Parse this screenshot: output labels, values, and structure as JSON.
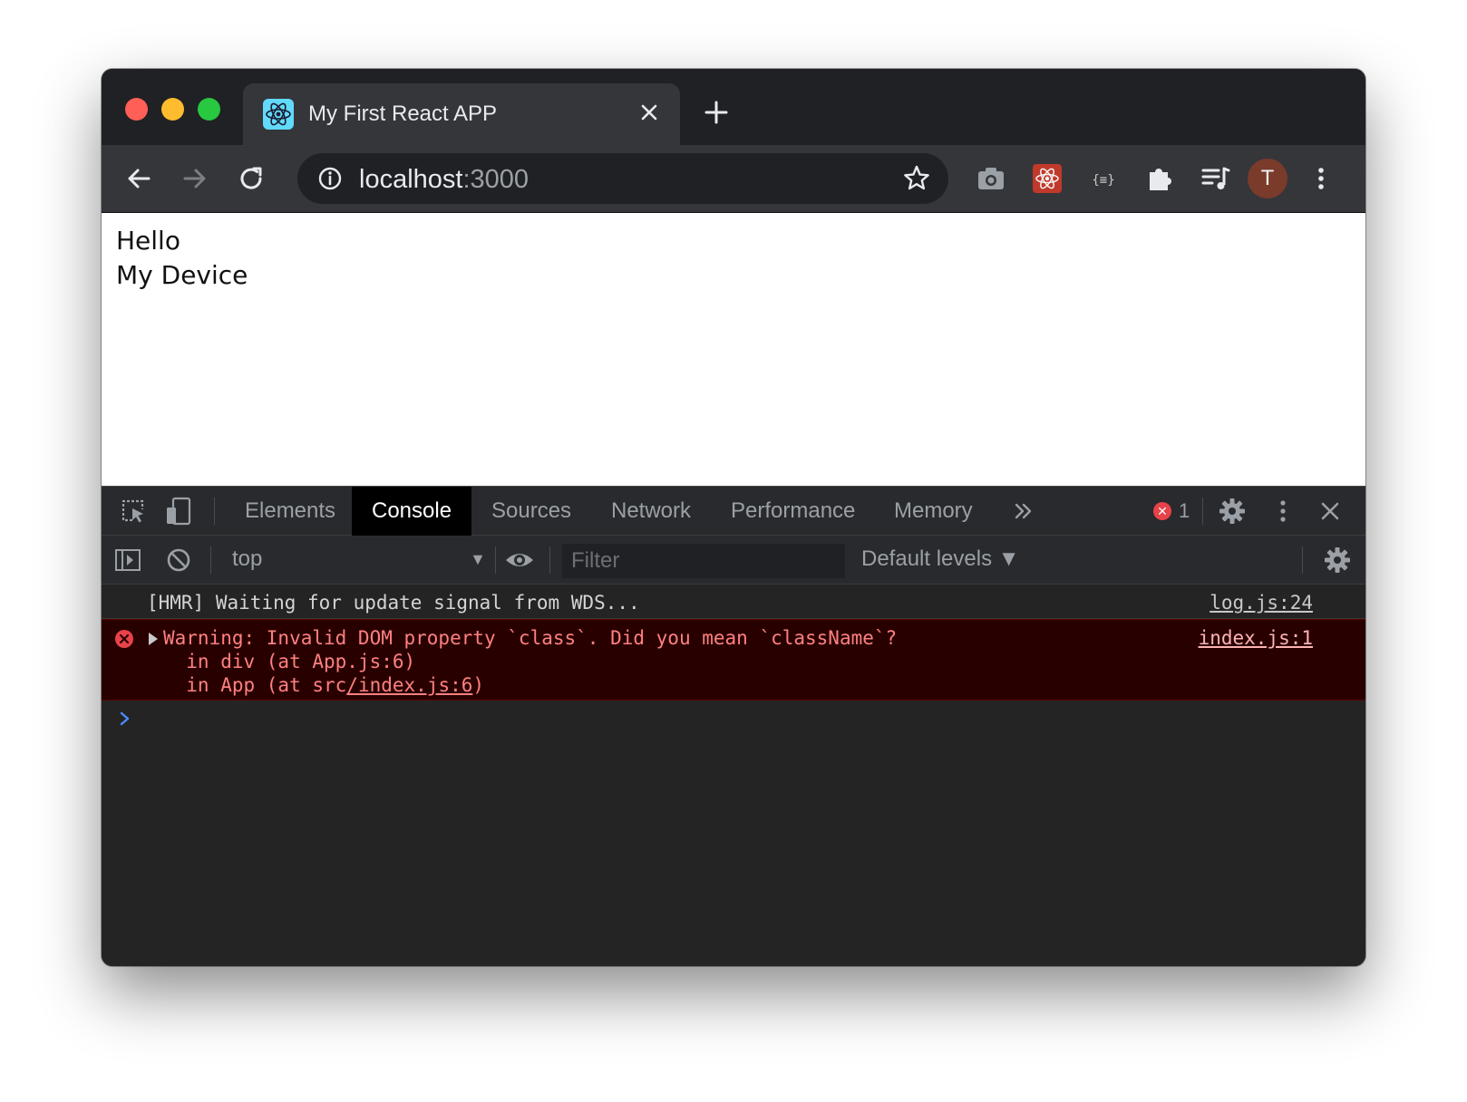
{
  "tab": {
    "title": "My First React APP"
  },
  "omnibox": {
    "host": "localhost",
    "port": ":3000"
  },
  "profile": {
    "initial": "T"
  },
  "page": {
    "lines": [
      "Hello",
      "My Device"
    ]
  },
  "devtools": {
    "tabs": [
      "Elements",
      "Console",
      "Sources",
      "Network",
      "Performance",
      "Memory"
    ],
    "active_tab": "Console",
    "error_count": "1",
    "context": "top",
    "filter_placeholder": "Filter",
    "levels": "Default levels ▼",
    "logs": {
      "info": {
        "message": "[HMR] Waiting for update signal from WDS...",
        "source": "log.js:24"
      },
      "error": {
        "message": "Warning: Invalid DOM property `class`. Did you mean `className`?",
        "source": "index.js:1",
        "stack1": "  in div (at App.js:6)",
        "stack2_prefix": "  in App (at src",
        "stack2_link": "/index.js:6",
        "stack2_suffix": ")"
      }
    }
  },
  "colors": {
    "error_red": "#e8424a",
    "console_bg": "#242424",
    "prompt_blue": "#4a8cff"
  }
}
